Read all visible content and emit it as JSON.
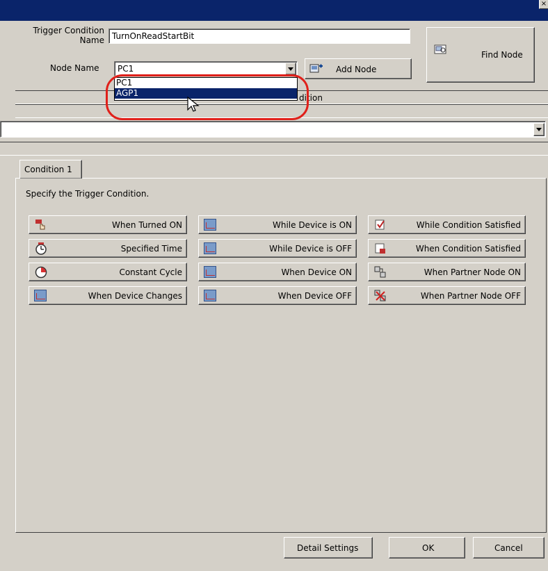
{
  "window": {
    "close_glyph": "×"
  },
  "form": {
    "trigger_condition_label_1": "Trigger Condition",
    "trigger_condition_label_2": "Name",
    "trigger_condition_value": "TurnOnReadStartBit",
    "node_name_label": "Node Name",
    "node_name_value": "PC1",
    "add_node_label": "Add Node",
    "find_node_label": "Find Node",
    "node_options": [
      "PC1",
      "AGP1"
    ],
    "selected_option_index": 1,
    "obscured_header_fragment": "dition"
  },
  "tabs": [
    {
      "label": "Condition 1"
    }
  ],
  "instruction": "Specify the Trigger Condition.",
  "condition_buttons": [
    {
      "label": "When Turned ON",
      "icon": "hand-press-icon"
    },
    {
      "label": "While Device is ON",
      "icon": "device-on-icon"
    },
    {
      "label": "While Condition Satisfied",
      "icon": "condition-satisfied-icon"
    },
    {
      "label": "Specified Time",
      "icon": "clock-icon"
    },
    {
      "label": "While Device is OFF",
      "icon": "device-off-icon"
    },
    {
      "label": "When Condition Satisfied",
      "icon": "condition-ok-icon"
    },
    {
      "label": "Constant Cycle",
      "icon": "cycle-clock-icon"
    },
    {
      "label": "When Device ON",
      "icon": "device-turn-on-icon"
    },
    {
      "label": "When Partner Node ON",
      "icon": "partner-node-on-icon"
    },
    {
      "label": "When Device Changes",
      "icon": "device-change-icon"
    },
    {
      "label": "When Device OFF",
      "icon": "device-turn-off-icon"
    },
    {
      "label": "When Partner Node OFF",
      "icon": "partner-node-off-icon"
    }
  ],
  "footer": {
    "detail_settings_label": "Detail Settings",
    "ok_label": "OK",
    "cancel_label": "Cancel"
  },
  "colors": {
    "titlebar": "#0a246a",
    "dialog_bg": "#d4d0c8",
    "highlight": "#0a246a",
    "annotation": "#e0201a"
  }
}
